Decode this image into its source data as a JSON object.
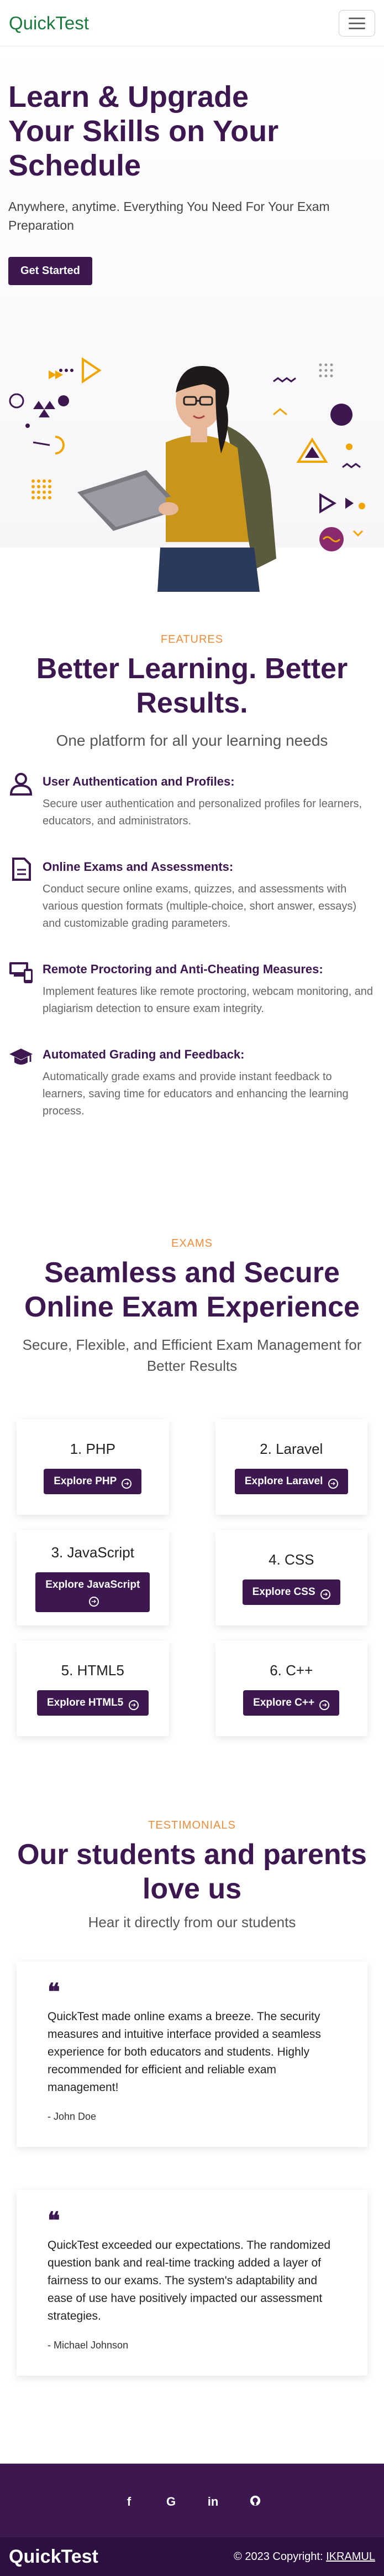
{
  "nav": {
    "brand": "QuickTest",
    "menu_icon": "hamburger-icon"
  },
  "hero": {
    "title": "Learn & Upgrade Your Skills on Your Schedule",
    "subtitle": "Anywhere, anytime. Everything You Need For Your Exam Preparation",
    "cta_label": "Get Started"
  },
  "features": {
    "tag": "FEATURES",
    "title": "Better Learning. Better Results.",
    "subtitle": "One platform for all your learning needs",
    "items": [
      {
        "icon": "user-icon",
        "title": "User Authentication and Profiles:",
        "text": "Secure user authentication and personalized profiles for learners, educators, and administrators."
      },
      {
        "icon": "document-icon",
        "title": "Online Exams and Assessments:",
        "text": "Conduct secure online exams, quizzes, and assessments with various question formats (multiple-choice, short answer, essays) and customizable grading parameters."
      },
      {
        "icon": "devices-icon",
        "title": "Remote Proctoring and Anti-Cheating Measures:",
        "text": "Implement features like remote proctoring, webcam monitoring, and plagiarism detection to ensure exam integrity."
      },
      {
        "icon": "graduation-cap-icon",
        "title": "Automated Grading and Feedback:",
        "text": "Automatically grade exams and provide instant feedback to learners, saving time for educators and enhancing the learning process."
      }
    ]
  },
  "exams": {
    "tag": "EXAMS",
    "title": "Seamless and Secure Online Exam Experience",
    "subtitle": "Secure, Flexible, and Efficient Exam Management for Better Results",
    "cards": [
      {
        "title": "1. PHP",
        "button": "Explore PHP"
      },
      {
        "title": "2. Laravel",
        "button": "Explore Laravel"
      },
      {
        "title": "3. JavaScript",
        "button": "Explore JavaScript"
      },
      {
        "title": "4. CSS",
        "button": "Explore CSS"
      },
      {
        "title": "5. HTML5",
        "button": "Explore HTML5"
      },
      {
        "title": "6. C++",
        "button": "Explore C++"
      }
    ]
  },
  "testimonials": {
    "tag": "TESTIMONIALS",
    "title": "Our students and parents love us",
    "subtitle": "Hear it directly from our students",
    "items": [
      {
        "quote": "QuickTest made online exams a breeze. The security measures and intuitive interface provided a seamless experience for both educators and students. Highly recommended for efficient and reliable exam management!",
        "author": "- John Doe"
      },
      {
        "quote": "QuickTest exceeded our expectations. The randomized question bank and real-time tracking added a layer of fairness to our exams. The system's adaptability and ease of use have positively impacted our assessment strategies.",
        "author": "- Michael Johnson"
      }
    ]
  },
  "footer": {
    "social": [
      "f",
      "G",
      "in",
      "gh"
    ],
    "brand": "QuickTest",
    "copyright": "© 2023 Copyright: ",
    "copyright_link": "IKRAMUL"
  },
  "colors": {
    "primary": "#3d1750",
    "accent": "#f08c3a",
    "brand_green": "#1b7a3e"
  }
}
